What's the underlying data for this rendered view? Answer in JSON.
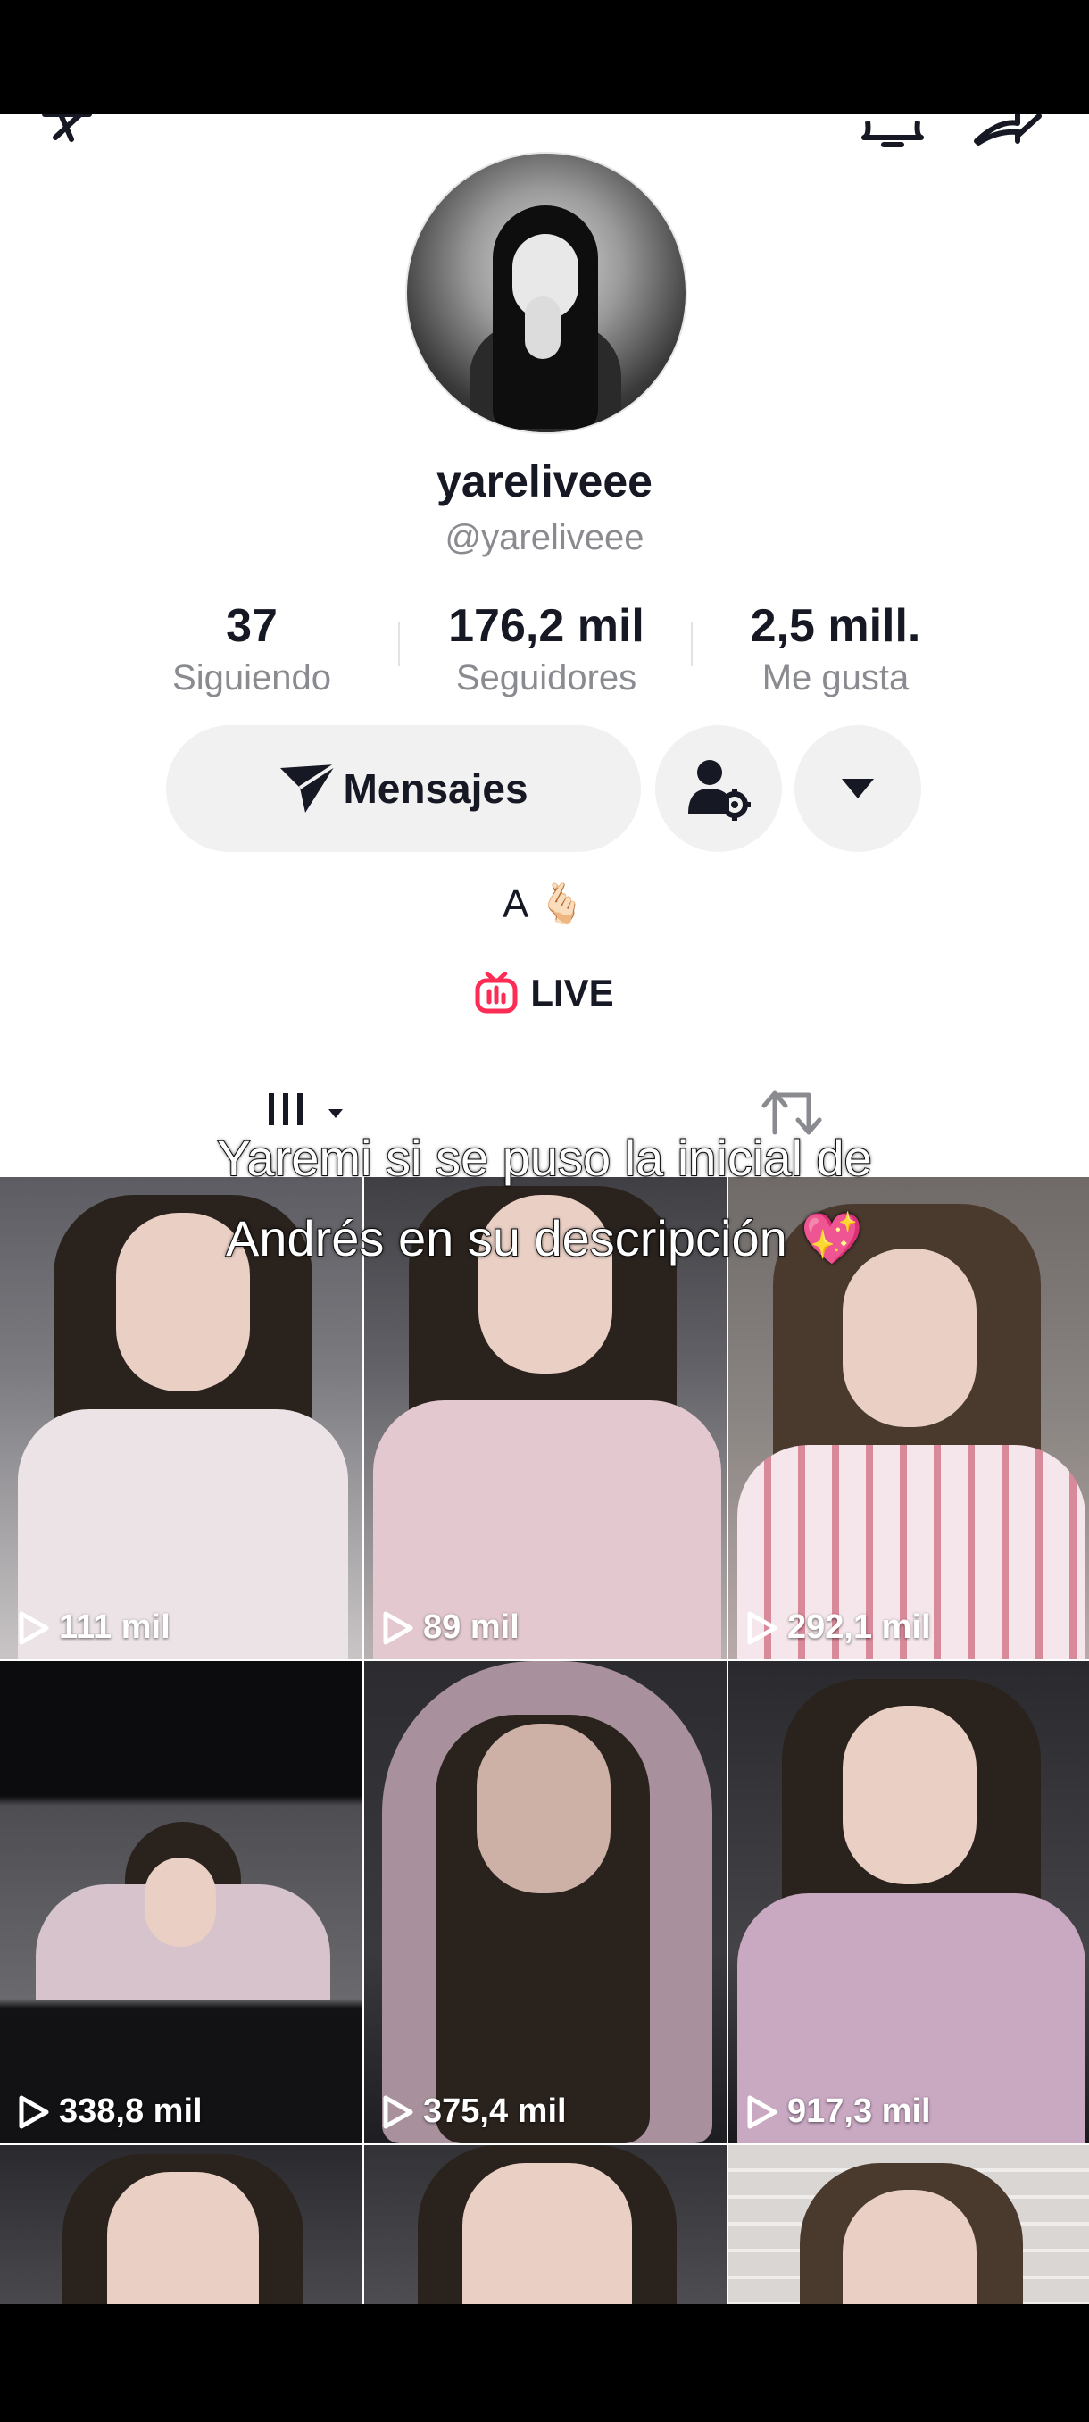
{
  "profile": {
    "display_name": "yareliveee",
    "handle": "@yareliveee",
    "bio": "A 🫰🏻"
  },
  "stats": [
    {
      "value": "37",
      "label": "Siguiendo"
    },
    {
      "value": "176,2 mil",
      "label": "Seguidores"
    },
    {
      "value": "2,5 mill.",
      "label": "Me gusta"
    }
  ],
  "actions": {
    "message_label": "Mensajes"
  },
  "live": {
    "label": "LIVE",
    "accent": "#fe2c55"
  },
  "caption": {
    "line1": "Yaremi si se puso la inicial de",
    "line2": "Andrés en su descripción 💖"
  },
  "videos": [
    {
      "views": "111 mil"
    },
    {
      "views": "89 mil"
    },
    {
      "views": "292,1 mil"
    },
    {
      "views": "338,8 mil"
    },
    {
      "views": "375,4 mil"
    },
    {
      "views": "917,3 mil"
    },
    {
      "views": ""
    },
    {
      "views": ""
    },
    {
      "views": ""
    }
  ]
}
